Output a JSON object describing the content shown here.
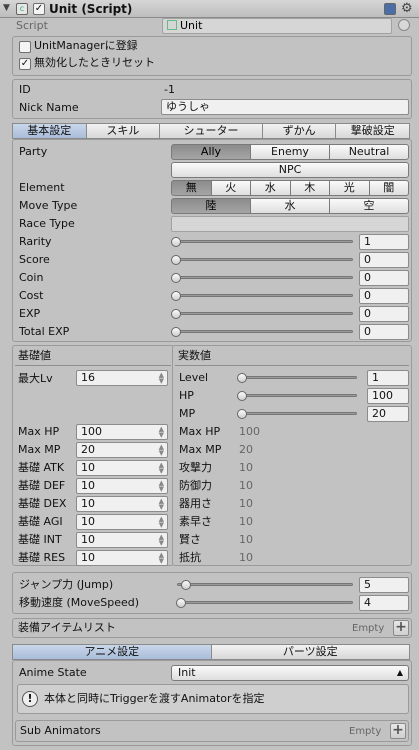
{
  "header": {
    "title": "Unit (Script)"
  },
  "script": {
    "label": "Script",
    "value": "Unit"
  },
  "options": [
    {
      "label": "UnitManagerに登録",
      "checked": false
    },
    {
      "label": "無効化したときリセット",
      "checked": true
    }
  ],
  "identity": {
    "id_label": "ID",
    "id_value": "-1",
    "nick_label": "Nick Name",
    "nick_value": "ゆうしゃ"
  },
  "tabs": [
    "基本設定",
    "スキル",
    "シューター",
    "ずかん",
    "撃破設定"
  ],
  "party": {
    "label": "Party",
    "options": [
      "Ally",
      "Enemy",
      "Neutral"
    ],
    "extra": "NPC",
    "selected": "Ally"
  },
  "element": {
    "label": "Element",
    "options": [
      "無",
      "火",
      "水",
      "木",
      "光",
      "闇"
    ],
    "selected": "無"
  },
  "move_type": {
    "label": "Move Type",
    "options": [
      "陸",
      "水",
      "空"
    ],
    "selected": "陸"
  },
  "race_type": {
    "label": "Race Type",
    "value": ""
  },
  "sliders": [
    {
      "label": "Rarity",
      "value": "1"
    },
    {
      "label": "Score",
      "value": "0"
    },
    {
      "label": "Coin",
      "value": "0"
    },
    {
      "label": "Cost",
      "value": "0"
    },
    {
      "label": "EXP",
      "value": "0"
    },
    {
      "label": "Total EXP",
      "value": "0"
    }
  ],
  "base": {
    "title": "基礎値",
    "max_lv_label": "最大Lv",
    "max_lv": "16",
    "stats": [
      {
        "label": "Max HP",
        "value": "100"
      },
      {
        "label": "Max MP",
        "value": "20"
      },
      {
        "label": "基礎 ATK",
        "value": "10"
      },
      {
        "label": "基礎 DEF",
        "value": "10"
      },
      {
        "label": "基礎 DEX",
        "value": "10"
      },
      {
        "label": "基礎 AGI",
        "value": "10"
      },
      {
        "label": "基礎 INT",
        "value": "10"
      },
      {
        "label": "基礎 RES",
        "value": "10"
      }
    ]
  },
  "actual": {
    "title": "実数値",
    "sliders": [
      {
        "label": "Level",
        "value": "1"
      },
      {
        "label": "HP",
        "value": "100"
      },
      {
        "label": "MP",
        "value": "20"
      }
    ],
    "stats": [
      {
        "label": "Max HP",
        "value": "100"
      },
      {
        "label": "Max MP",
        "value": "20"
      },
      {
        "label": "攻撃力",
        "value": "10"
      },
      {
        "label": "防御力",
        "value": "10"
      },
      {
        "label": "器用さ",
        "value": "10"
      },
      {
        "label": "素早さ",
        "value": "10"
      },
      {
        "label": "賢さ",
        "value": "10"
      },
      {
        "label": "抵抗",
        "value": "10"
      }
    ]
  },
  "movement": [
    {
      "label": "ジャンプ力 (Jump)",
      "value": "5"
    },
    {
      "label": "移動速度 (MoveSpeed)",
      "value": "4"
    }
  ],
  "equip": {
    "label": "装備アイテムリスト",
    "empty": "Empty"
  },
  "tabs2": [
    "アニメ設定",
    "パーツ設定"
  ],
  "anime": {
    "label": "Anime State",
    "value": "Init",
    "info": "本体と同時にTriggerを渡すAnimatorを指定"
  },
  "sub": {
    "label": "Sub Animators",
    "empty": "Empty"
  }
}
